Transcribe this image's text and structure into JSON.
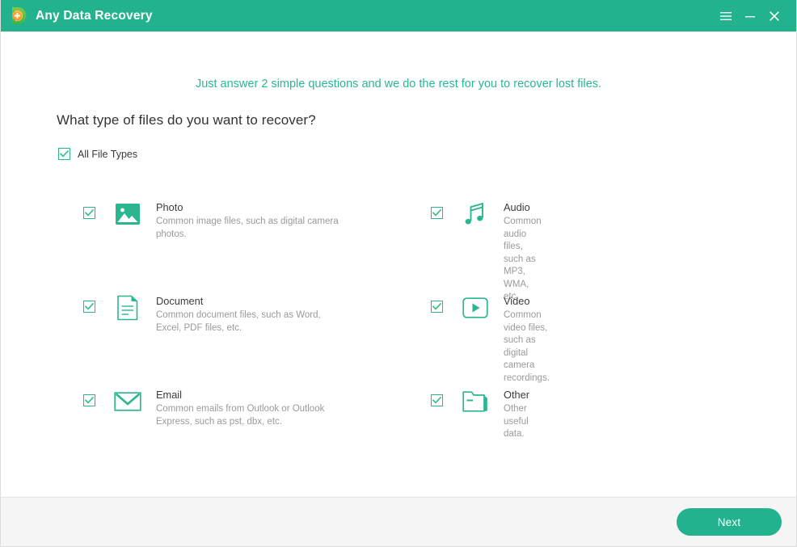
{
  "window": {
    "app_title": "Any Data Recovery",
    "logo_icon": "letter-d-plus-logo",
    "controls": [
      {
        "name": "menu-button",
        "icon": "hamburger-menu-icon"
      },
      {
        "name": "minimize-button",
        "icon": "minimize-icon"
      },
      {
        "name": "close-button",
        "icon": "close-icon"
      }
    ]
  },
  "main": {
    "tagline": "Just answer 2 simple questions and we do the rest for you to recover lost files.",
    "question": "What type of files do you want to recover?",
    "all_file_types": {
      "label": "All File Types",
      "checked": true
    },
    "file_types": [
      {
        "id": "photo",
        "title": "Photo",
        "description": "Common image files, such as digital camera photos.",
        "icon": "photo-icon",
        "checked": true
      },
      {
        "id": "audio",
        "title": "Audio",
        "description": "Common audio files, such as MP3, WMA, etc.",
        "icon": "audio-note-icon",
        "checked": true
      },
      {
        "id": "document",
        "title": "Document",
        "description": "Common document files, such as Word, Excel, PDF files, etc.",
        "icon": "document-icon",
        "checked": true
      },
      {
        "id": "video",
        "title": "Video",
        "description": "Common video files, such as digital camera recordings.",
        "icon": "video-play-icon",
        "checked": true
      },
      {
        "id": "email",
        "title": "Email",
        "description": "Common emails from Outlook or Outlook Express, such as pst, dbx, etc.",
        "icon": "email-envelope-icon",
        "checked": true
      },
      {
        "id": "other",
        "title": "Other",
        "description": "Other useful data.",
        "icon": "folder-icon",
        "checked": true
      }
    ]
  },
  "footer": {
    "next_label": "Next"
  },
  "colors": {
    "header_green": "#22b28d",
    "accent_green": "#2bb694",
    "tagline_green": "#2bb694",
    "icon_green": "#2bb68f",
    "title_text": "#3c3c3c",
    "desc_text": "#9a9a9a",
    "footer_bg": "#f5f5f5",
    "logo_orange": "#f7941e"
  }
}
